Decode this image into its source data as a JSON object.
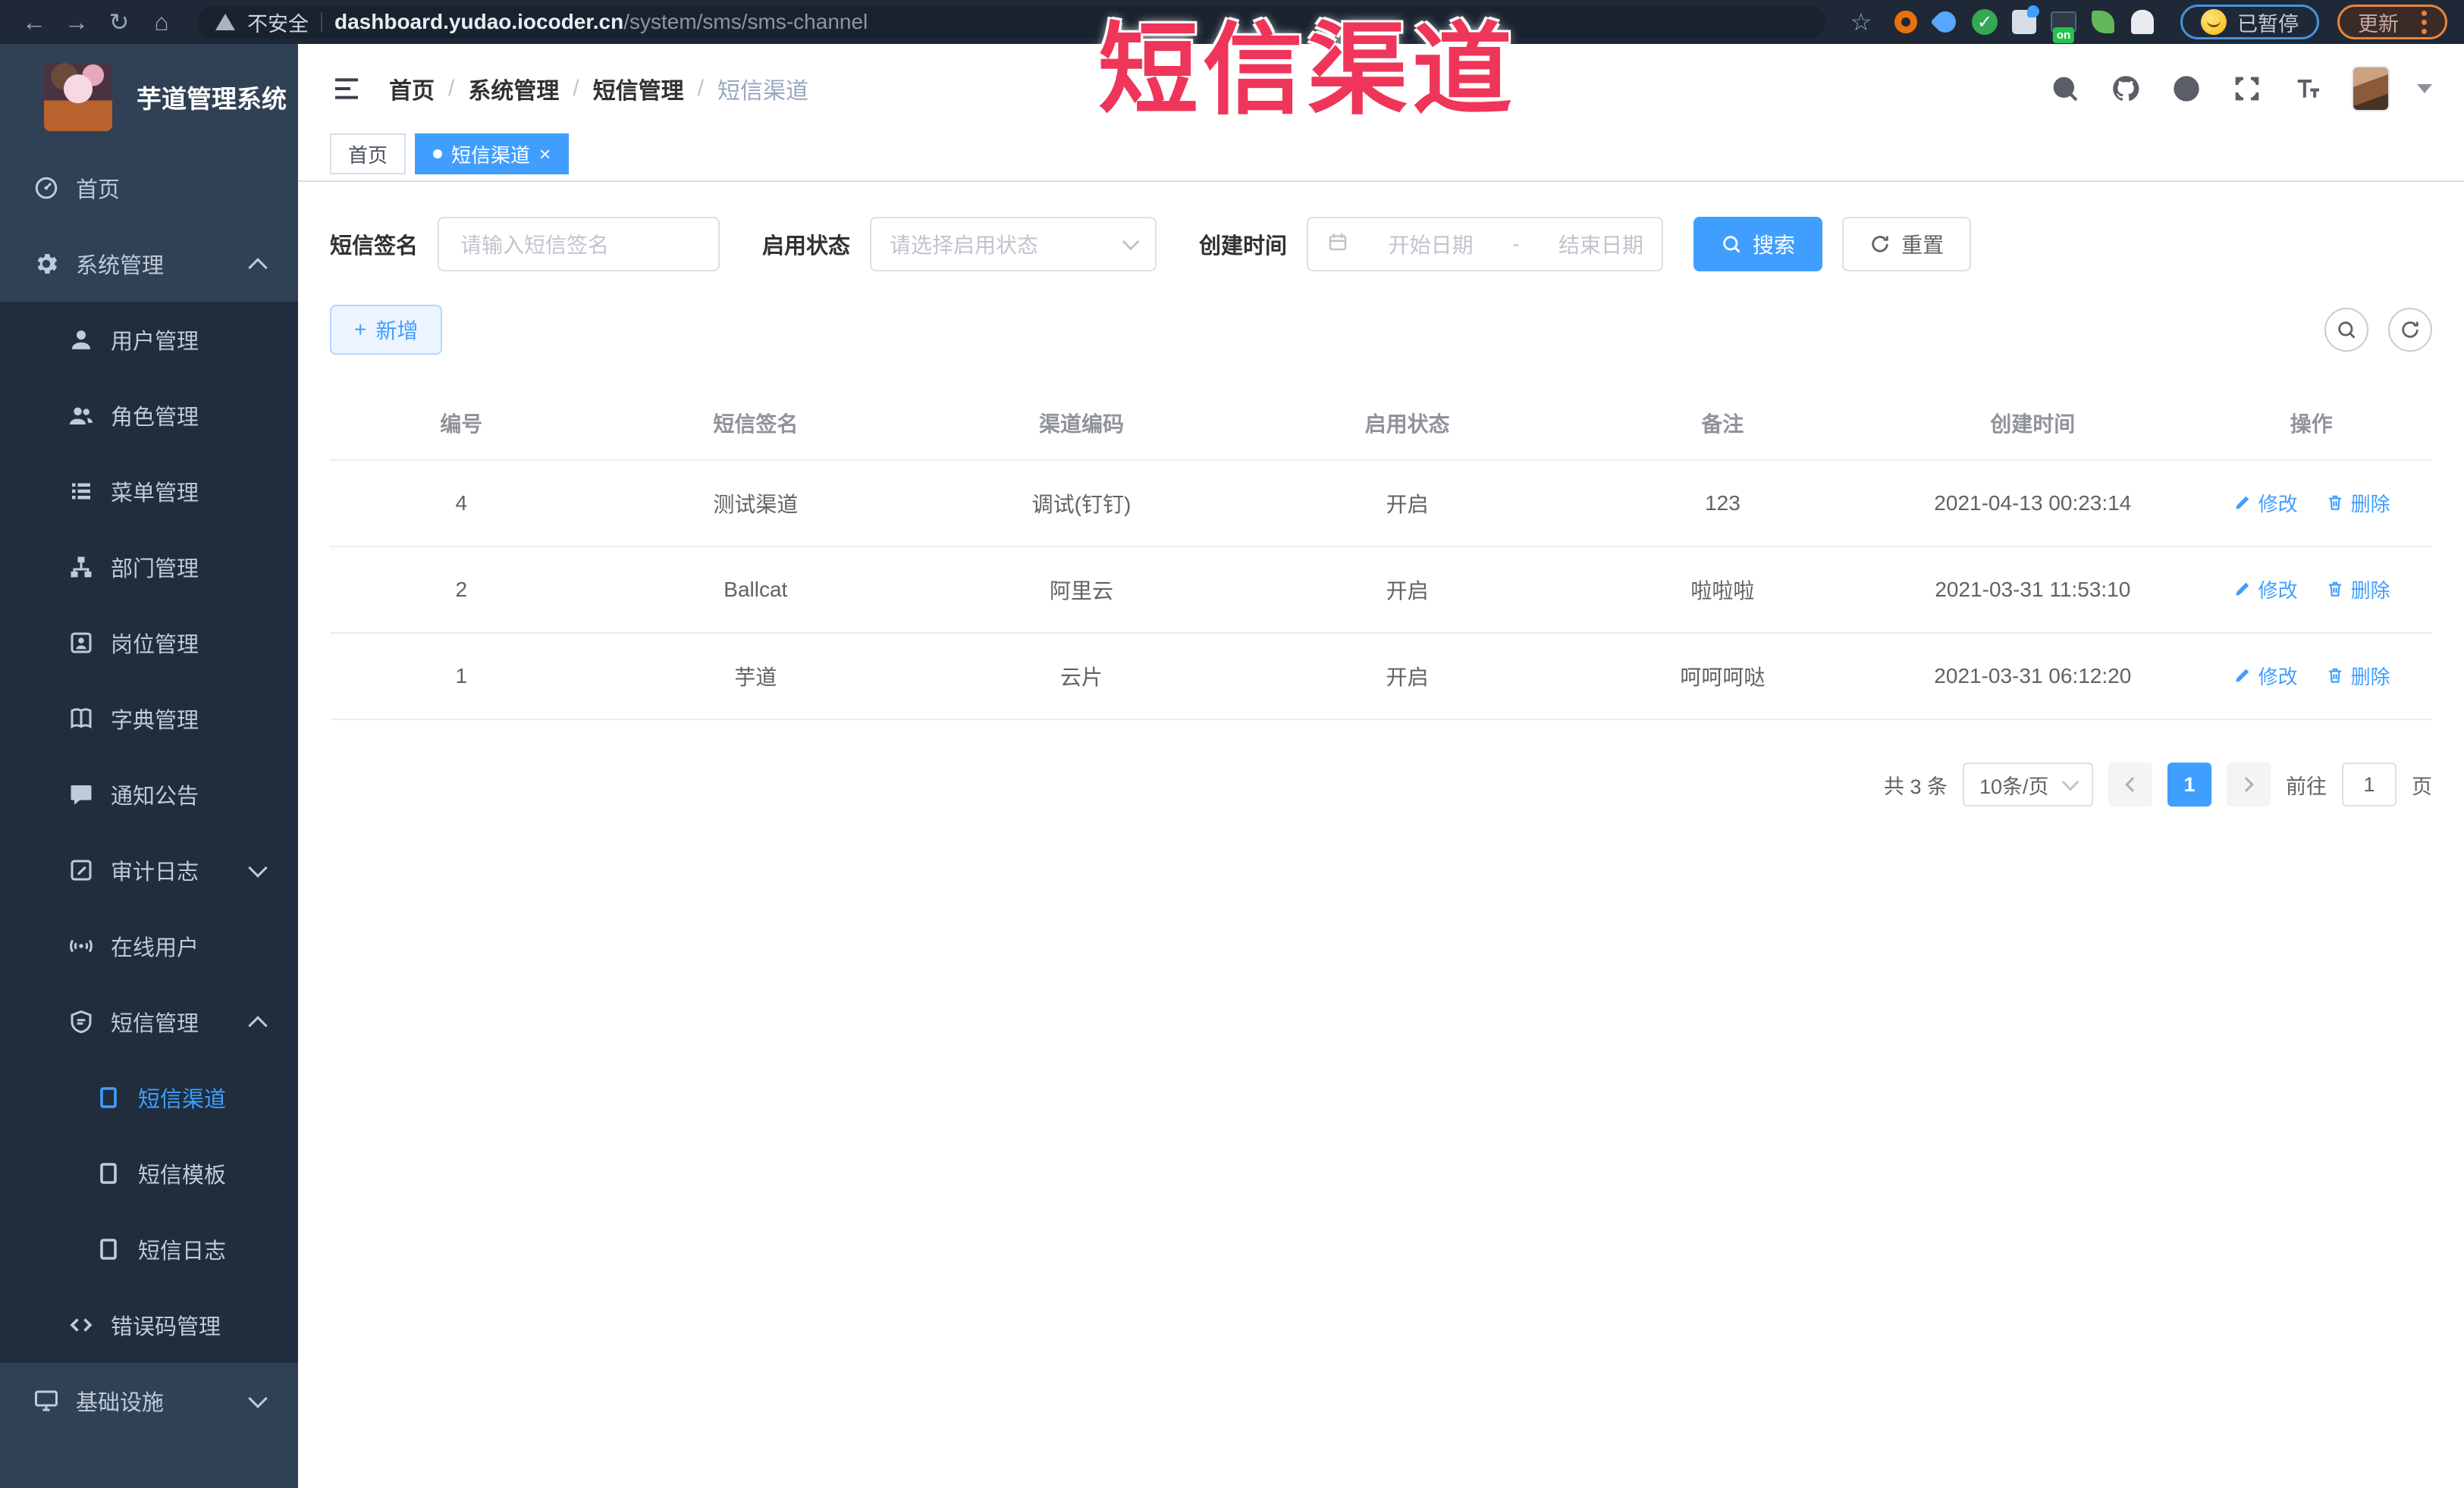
{
  "browser": {
    "security_label": "不安全",
    "url_domain": "dashboard.yudao.iocoder.cn",
    "url_path": "/system/sms/sms-channel",
    "extensions": [
      "orange-ring",
      "blue-drop",
      "green-check",
      "grid-blue-drop",
      "screen-on-badge",
      "green-leaf",
      "white-ghost"
    ],
    "screen_badge": "on",
    "paused_label": "已暂停",
    "update_label": "更新"
  },
  "overlay": {
    "title": "短信渠道",
    "color": "#ef3559"
  },
  "sidebar": {
    "title": "芋道管理系统",
    "items": [
      {
        "label": "首页",
        "level": 1,
        "icon": "home",
        "dark": false
      },
      {
        "label": "系统管理",
        "level": 1,
        "icon": "gear",
        "arrow": "up",
        "dark": false
      },
      {
        "label": "用户管理",
        "level": 2,
        "icon": "user",
        "dark": true
      },
      {
        "label": "角色管理",
        "level": 2,
        "icon": "users",
        "dark": true
      },
      {
        "label": "菜单管理",
        "level": 2,
        "icon": "list",
        "dark": true
      },
      {
        "label": "部门管理",
        "level": 2,
        "icon": "tree",
        "dark": true
      },
      {
        "label": "岗位管理",
        "level": 2,
        "icon": "badge",
        "dark": true
      },
      {
        "label": "字典管理",
        "level": 2,
        "icon": "book",
        "dark": true
      },
      {
        "label": "通知公告",
        "level": 2,
        "icon": "chat",
        "dark": true
      },
      {
        "label": "审计日志",
        "level": 2,
        "icon": "log",
        "arrow": "down",
        "dark": true
      },
      {
        "label": "在线用户",
        "level": 2,
        "icon": "online",
        "dark": true
      },
      {
        "label": "短信管理",
        "level": 2,
        "icon": "sms",
        "arrow": "up",
        "dark": true
      },
      {
        "label": "短信渠道",
        "level": 3,
        "icon": "doc",
        "active": true,
        "dark": true
      },
      {
        "label": "短信模板",
        "level": 3,
        "icon": "doc",
        "dark": true
      },
      {
        "label": "短信日志",
        "level": 3,
        "icon": "doc",
        "dark": true
      },
      {
        "label": "错误码管理",
        "level": 2,
        "icon": "code",
        "dark": true
      },
      {
        "label": "基础设施",
        "level": 1,
        "icon": "monitor",
        "arrow": "down",
        "dark": false
      }
    ]
  },
  "header": {
    "breadcrumb": [
      "首页",
      "系统管理",
      "短信管理",
      "短信渠道"
    ],
    "separator": "/"
  },
  "tabs": [
    {
      "label": "首页",
      "active": false,
      "closable": false
    },
    {
      "label": "短信渠道",
      "active": true,
      "closable": true,
      "close_symbol": "×"
    }
  ],
  "filters": {
    "signature_label": "短信签名",
    "signature_placeholder": "请输入短信签名",
    "status_label": "启用状态",
    "status_placeholder": "请选择启用状态",
    "time_label": "创建时间",
    "start_placeholder": "开始日期",
    "range_separator": "-",
    "end_placeholder": "结束日期",
    "search_label": "搜索",
    "reset_label": "重置"
  },
  "toolbar": {
    "add_label": "新增",
    "add_symbol": "+"
  },
  "table": {
    "columns": [
      "编号",
      "短信签名",
      "渠道编码",
      "启用状态",
      "备注",
      "创建时间",
      "操作"
    ],
    "edit_label": "修改",
    "delete_label": "删除",
    "rows": [
      {
        "id": "4",
        "signature": "测试渠道",
        "code": "调试(钉钉)",
        "status": "开启",
        "remark": "123",
        "created": "2021-04-13 00:23:14"
      },
      {
        "id": "2",
        "signature": "Ballcat",
        "code": "阿里云",
        "status": "开启",
        "remark": "啦啦啦",
        "created": "2021-03-31 11:53:10"
      },
      {
        "id": "1",
        "signature": "芋道",
        "code": "云片",
        "status": "开启",
        "remark": "呵呵呵哒",
        "created": "2021-03-31 06:12:20"
      }
    ]
  },
  "pagination": {
    "total_label": "共 3 条",
    "page_size_label": "10条/页",
    "current_page": "1",
    "goto_label": "前往",
    "goto_value": "1",
    "page_suffix": "页"
  },
  "colors": {
    "accent": "#409eff",
    "sidebar_bg": "#304156",
    "submenu_bg": "#1f2d3d"
  }
}
